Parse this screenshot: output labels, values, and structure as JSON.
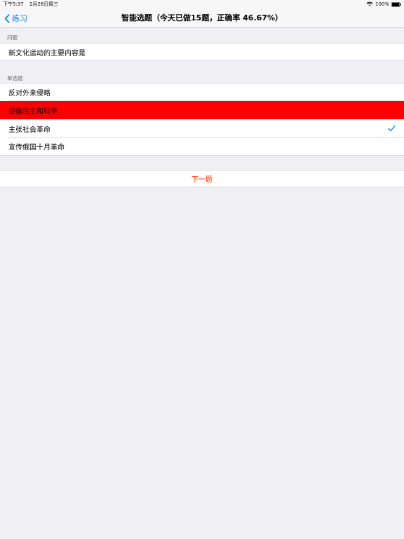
{
  "status_bar": {
    "time": "下午5:37",
    "date": "2月26日周三",
    "battery": "100%"
  },
  "nav": {
    "back_label": "练习",
    "title": "智能选题（今天已做15题，正确率 46.67%）"
  },
  "question_section": {
    "header": "问题",
    "text": "新文化运动的主要内容是"
  },
  "options_section": {
    "header": "单选题",
    "options": [
      {
        "label": "反对外来侵略",
        "state": "normal"
      },
      {
        "label": "提倡民主和科学",
        "state": "selected-wrong"
      },
      {
        "label": "主张社会革命",
        "state": "correct"
      },
      {
        "label": "宣传俄国十月革命",
        "state": "normal"
      }
    ]
  },
  "next_button": {
    "label": "下一题"
  },
  "colors": {
    "accent": "#007aff",
    "wrong_highlight": "#ff0000",
    "next_text": "#ff2a00",
    "background": "#efeff4"
  },
  "icons": {
    "back": "chevron-left-icon",
    "check": "checkmark-icon",
    "wifi": "wifi-icon",
    "battery": "battery-icon"
  }
}
